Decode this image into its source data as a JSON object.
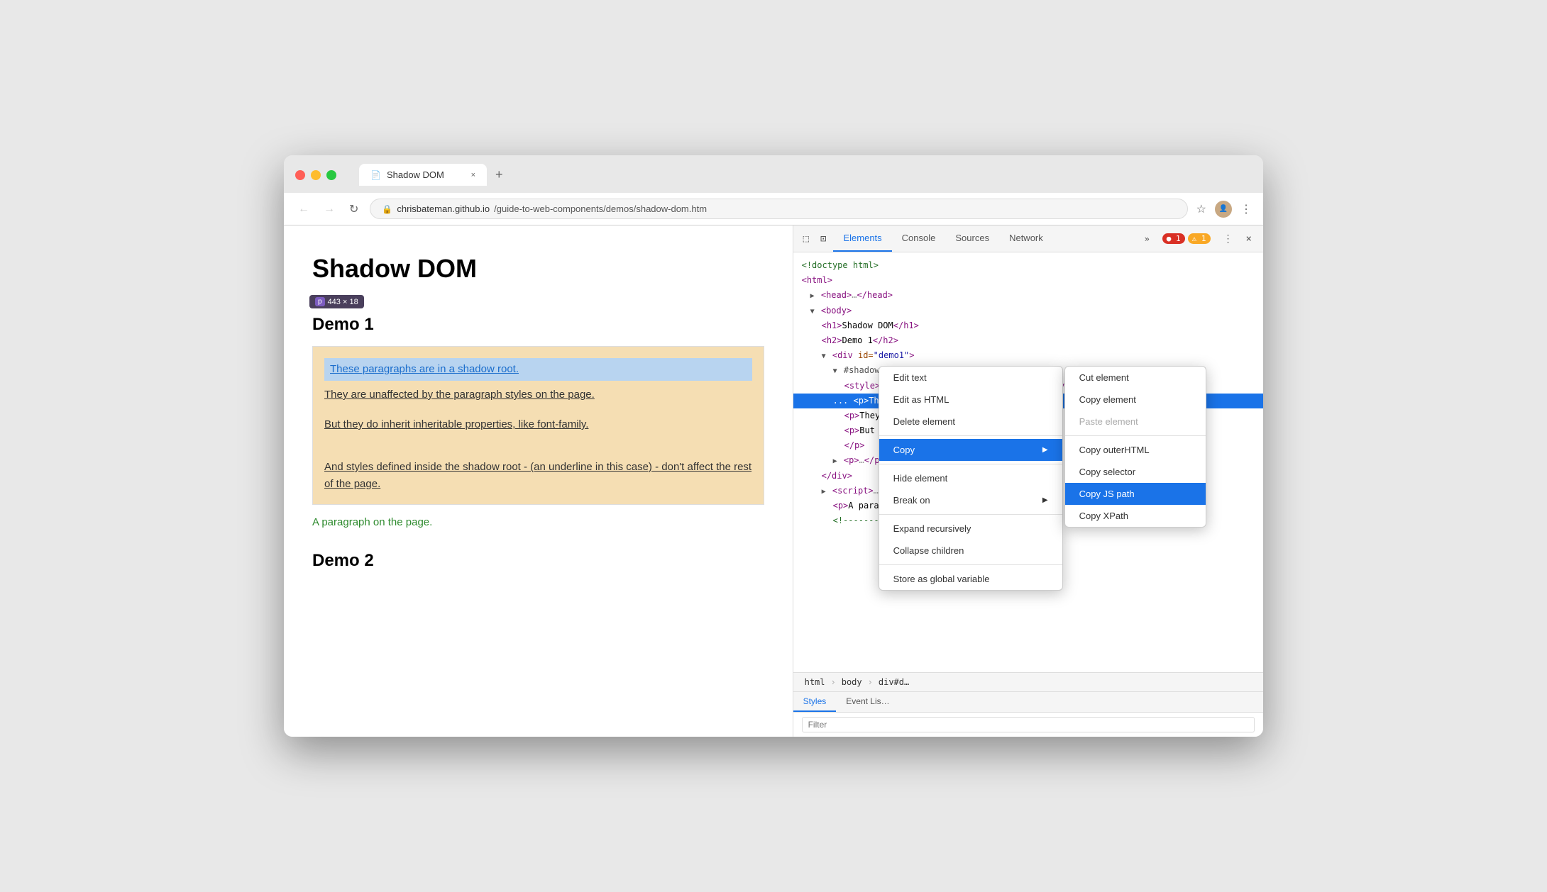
{
  "browser": {
    "tab_title": "Shadow DOM",
    "tab_icon": "📄",
    "tab_close": "×",
    "new_tab_btn": "+",
    "nav": {
      "back": "←",
      "forward": "→",
      "refresh": "↻"
    },
    "url": {
      "lock_icon": "🔒",
      "full": "chrisbateman.github.io/guide-to-web-components/demos/shadow-dom.htm",
      "base": "chrisbateman.github.io",
      "path": "/guide-to-web-components/demos/shadow-dom.htm"
    },
    "bookmark_icon": "☆",
    "more_icon": "⋮"
  },
  "page": {
    "title": "Shadow DOM",
    "demo1_heading": "Demo 1",
    "size_tooltip": {
      "letter": "p",
      "size": "443 × 18"
    },
    "shadow_box_texts": [
      "These paragraphs are in a shadow root.",
      "They are unaffected by the paragraph styles on the page.",
      "But they do inherit inheritable properties, like font-family.",
      "And styles defined inside the shadow root - (an underline in this case) - don't affect the rest of the page."
    ],
    "page_paragraph": "A paragraph on the page.",
    "demo2_heading": "Demo 2"
  },
  "devtools": {
    "tools": {
      "inspect_icon": "⬚",
      "device_icon": "📱"
    },
    "tabs": [
      {
        "label": "Elements",
        "active": true
      },
      {
        "label": "Console",
        "active": false
      },
      {
        "label": "Sources",
        "active": false
      },
      {
        "label": "Network",
        "active": false
      }
    ],
    "more_tabs": "»",
    "error_count": "1",
    "warn_count": "1",
    "settings_icon": "⚙",
    "close_icon": "×",
    "dom": {
      "lines": [
        {
          "indent": 0,
          "content": "<!doctype html>"
        },
        {
          "indent": 0,
          "content": "<html>"
        },
        {
          "indent": 1,
          "content": "▶ <head>…</head>"
        },
        {
          "indent": 1,
          "content": "▼ <body>"
        },
        {
          "indent": 2,
          "content": "<h1>Shadow DOM</h1>"
        },
        {
          "indent": 2,
          "content": "<h2>Demo 1</h2>"
        },
        {
          "indent": 2,
          "content": "▼ <div id=\"demo1\">"
        },
        {
          "indent": 3,
          "content": "▼ #shadow-root (open)"
        },
        {
          "indent": 4,
          "content": "<style>p {text-decoration: underline;}</style>"
        },
        {
          "indent": 3,
          "content": "...  <p>These…shadow root.</p>  == $0",
          "highlighted": true
        },
        {
          "indent": 4,
          "content": "<p>They… styles on the page.</p>"
        },
        {
          "indent": 4,
          "content": "<p>But i… properties, like font-family."
        },
        {
          "indent": 4,
          "content": "</p>"
        },
        {
          "indent": 3,
          "content": "▶ <p>…</p>"
        },
        {
          "indent": 2,
          "content": "</div>"
        },
        {
          "indent": 2,
          "content": "▶ <script>…</"
        },
        {
          "indent": 3,
          "content": "<p>A paragr…"
        },
        {
          "indent": 3,
          "content": "<!--------"
        }
      ]
    },
    "breadcrumb": [
      "html",
      "body",
      "div#d…"
    ],
    "styles_tabs": [
      "Styles",
      "Event Lis…"
    ],
    "filter_placeholder": "Filter"
  },
  "context_menu": {
    "items": [
      {
        "label": "Edit text",
        "id": "edit-text"
      },
      {
        "label": "Edit as HTML",
        "id": "edit-html"
      },
      {
        "label": "Delete element",
        "id": "delete-element"
      },
      {
        "separator": true
      },
      {
        "label": "Copy",
        "id": "copy",
        "has_submenu": true,
        "active": true
      },
      {
        "separator": true
      },
      {
        "label": "Hide element",
        "id": "hide-element"
      },
      {
        "label": "Break on",
        "id": "break-on",
        "has_submenu": true
      },
      {
        "separator": true
      },
      {
        "label": "Expand recursively",
        "id": "expand-recursively"
      },
      {
        "label": "Collapse children",
        "id": "collapse-children"
      },
      {
        "separator": true
      },
      {
        "label": "Store as global variable",
        "id": "store-global"
      }
    ]
  },
  "sub_context_menu": {
    "items": [
      {
        "label": "Cut element",
        "id": "cut-element"
      },
      {
        "label": "Copy element",
        "id": "copy-element"
      },
      {
        "label": "Paste element",
        "id": "paste-element",
        "disabled": true
      },
      {
        "separator": true
      },
      {
        "label": "Copy outerHTML",
        "id": "copy-outerhtml"
      },
      {
        "label": "Copy selector",
        "id": "copy-selector"
      },
      {
        "label": "Copy JS path",
        "id": "copy-js-path",
        "active": true
      },
      {
        "label": "Copy XPath",
        "id": "copy-xpath"
      }
    ]
  }
}
